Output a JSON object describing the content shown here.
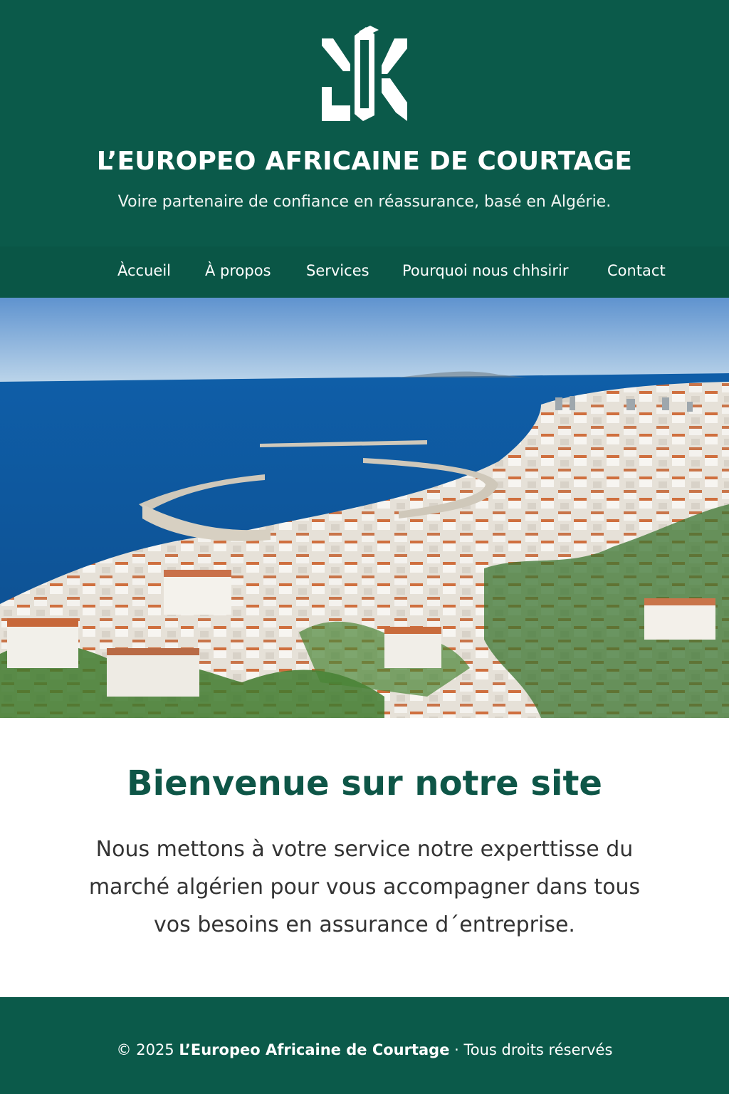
{
  "header": {
    "title": "L’EUROPEO AFRICAINE DE COURTAGE",
    "tagline": "Voire partenaire de confiance en réassurance, basé en Algérie.",
    "background_color": "#0b5a4a",
    "logo_icon": "ak-monogram-logo"
  },
  "nav": {
    "items": [
      {
        "label": "Àccueil"
      },
      {
        "label": "À propos"
      },
      {
        "label": "Services"
      },
      {
        "label": "Pourquoi nous chhsirir"
      },
      {
        "label": "Contact"
      }
    ]
  },
  "hero": {
    "image": "aerial-coastal-city-photo"
  },
  "welcome": {
    "title": "Bienvenue sur notre site",
    "text": "Nous mettons à votre service notre experttisse du marché algérien pour vous accompagner dans tous vos besoins en assurance d´entreprise.",
    "title_color": "#0e5647"
  },
  "footer": {
    "prefix": "© 2025 ",
    "company": "L’Europeo Africaine de Courtage",
    "suffix": " · Tous droits réservés"
  }
}
